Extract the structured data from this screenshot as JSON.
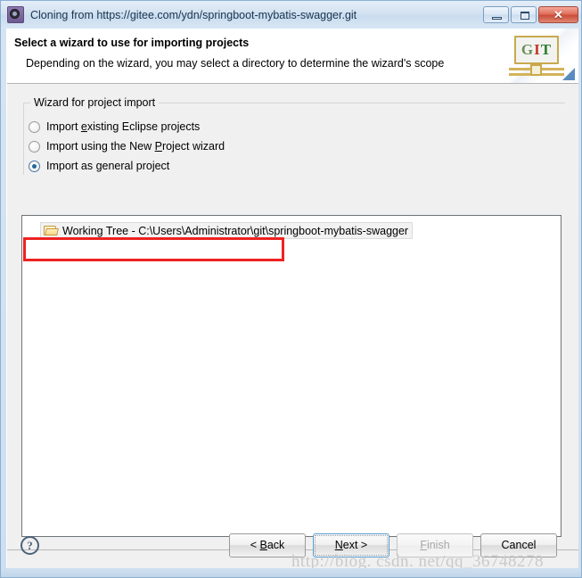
{
  "window": {
    "title": "Cloning from https://gitee.com/ydn/springboot-mybatis-swagger.git",
    "icon": "gear-icon",
    "controls": {
      "minimize": "minimize-icon",
      "maximize": "maximize-icon",
      "close": "✕"
    }
  },
  "header": {
    "title": "Select a wizard to use for importing projects",
    "description": "Depending on the wizard, you may select a directory to determine the wizard's scope",
    "banner": {
      "letters": [
        "G",
        "I",
        "T"
      ],
      "alt": "git-banner-icon"
    }
  },
  "group": {
    "label": "Wizard for project import",
    "options": [
      {
        "pre": "Import ",
        "mnemonic": "e",
        "post": "xisting Eclipse projects",
        "full": "Import existing Eclipse projects",
        "selected": false
      },
      {
        "pre": "Import using the New ",
        "mnemonic": "P",
        "post": "roject wizard",
        "full": "Import using the New Project wizard",
        "selected": false
      },
      {
        "pre": "Import as ",
        "mnemonic": "g",
        "post": "eneral project",
        "full": "Import as general project",
        "selected": true
      }
    ]
  },
  "highlight": {
    "color": "#ee2222",
    "target": "Import as general project"
  },
  "tree": {
    "items": [
      {
        "icon": "folder-icon",
        "label": "Working Tree - C:\\Users\\Administrator\\git\\springboot-mybatis-swagger",
        "selected": true
      }
    ]
  },
  "footer": {
    "help": "?",
    "buttons": [
      {
        "name": "back",
        "pre": "< ",
        "mnemonic": "B",
        "post": "ack",
        "full": "< Back",
        "enabled": true,
        "focused": false
      },
      {
        "name": "next",
        "pre": "",
        "mnemonic": "N",
        "post": "ext >",
        "full": "Next >",
        "enabled": true,
        "focused": true
      },
      {
        "name": "finish",
        "pre": "",
        "mnemonic": "F",
        "post": "inish",
        "full": "Finish",
        "enabled": false,
        "focused": false
      },
      {
        "name": "cancel",
        "pre": "Cancel",
        "mnemonic": "",
        "post": "",
        "full": "Cancel",
        "enabled": true,
        "focused": false
      }
    ]
  },
  "watermark": {
    "text": "http://blog. csdn. net/qq_36748278"
  }
}
